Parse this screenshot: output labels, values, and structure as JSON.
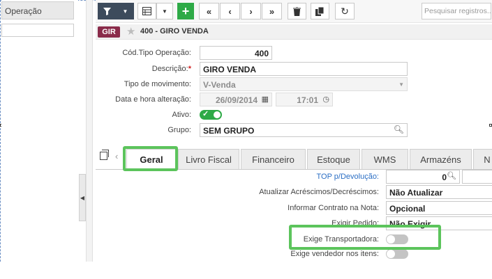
{
  "left_panel": {
    "header": "Operação",
    "filter_value": ""
  },
  "toolbar": {
    "search_placeholder": "Pesquisar registros...",
    "icons": [
      "filter-icon",
      "dropdown-caret-icon",
      "grid-icon",
      "dropdown-caret-icon",
      "plus-icon",
      "first-icon",
      "prev-icon",
      "next-icon",
      "last-icon",
      "trash-icon",
      "copy-icon",
      "refresh-icon"
    ]
  },
  "title": {
    "badge": "GIR",
    "text": "400 - GIRO VENDA"
  },
  "form": {
    "cod_tipo_label": "Cód.Tipo Operação:",
    "cod_tipo_value": "400",
    "descricao_label": "Descrição:",
    "descricao_required": "*",
    "descricao_value": "GIRO VENDA",
    "tipo_mov_label": "Tipo de movimento:",
    "tipo_mov_value": "V-Venda",
    "data_hora_label": "Data e hora alteração:",
    "data_value": "26/09/2014",
    "hora_value": "17:01",
    "ativo_label": "Ativo:",
    "ativo_on": true,
    "grupo_label": "Grupo:",
    "grupo_value": "SEM GRUPO"
  },
  "tabs": [
    "Geral",
    "Livro Fiscal",
    "Financeiro",
    "Estoque",
    "WMS",
    "Armazéns",
    "N"
  ],
  "active_tab": "Geral",
  "geral": {
    "top_devolucao_label": "TOP p/Devolução:",
    "top_devolucao_value": "0",
    "atualizar_label": "Atualizar Acréscimos/Decréscimos:",
    "atualizar_value": "Não Atualizar",
    "informar_label": "Informar Contrato na Nota:",
    "informar_value": "Opcional",
    "exigir_pedido_label": "Exigir Pedido:",
    "exigir_pedido_value": "Não Exigir",
    "exige_transp_label": "Exige Transportadora:",
    "exige_transp_on": false,
    "exige_vend_label": "Exige vendedor nos itens:",
    "exige_vend_on": false
  },
  "colors": {
    "accent_green": "#2eaa47",
    "highlight_green": "#5cc45c",
    "badge": "#8a2b4a",
    "dark_button": "#3d4b5c"
  }
}
